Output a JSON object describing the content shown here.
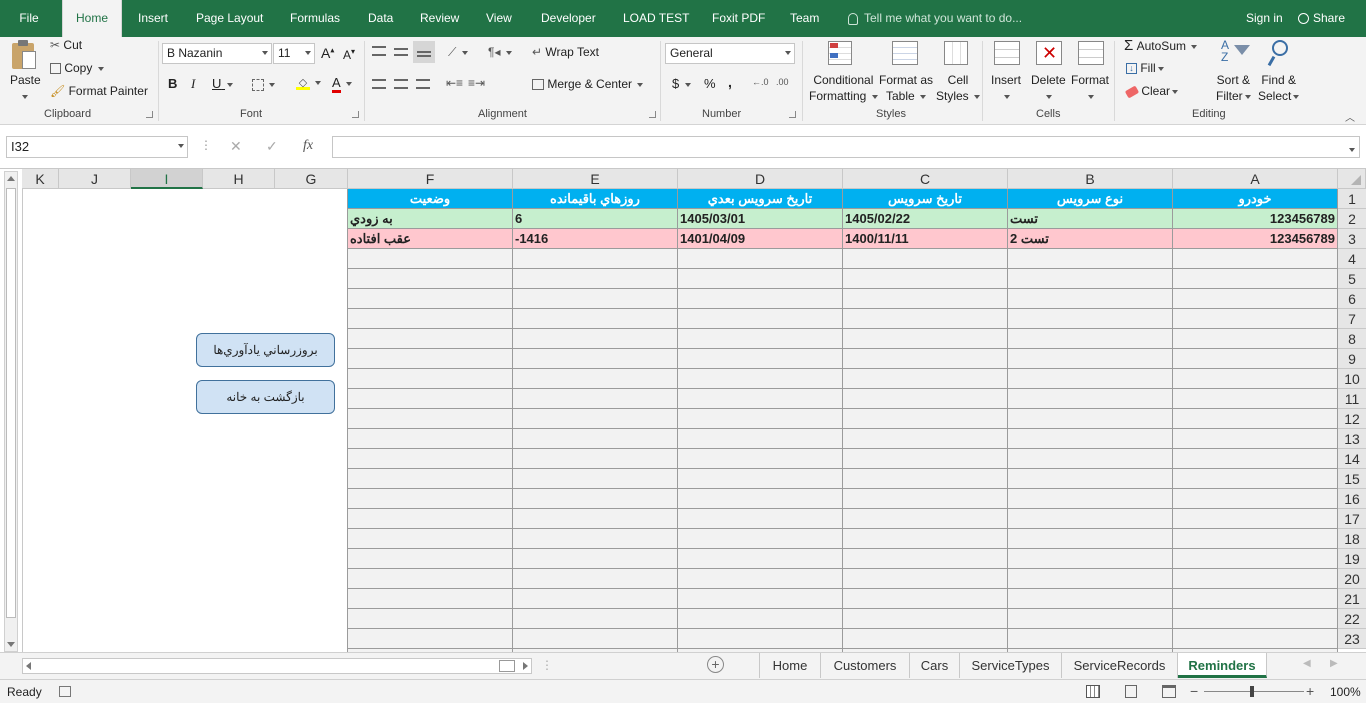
{
  "ribbon_tabs": {
    "file": "File",
    "home": "Home",
    "insert": "Insert",
    "page_layout": "Page Layout",
    "formulas": "Formulas",
    "data": "Data",
    "review": "Review",
    "view": "View",
    "developer": "Developer",
    "load_test": "LOAD TEST",
    "foxit": "Foxit PDF",
    "team": "Team",
    "tell_me": "Tell me what you want to do...",
    "sign_in": "Sign in",
    "share": "Share"
  },
  "clipboard": {
    "paste": "Paste",
    "cut": "Cut",
    "copy": "Copy",
    "format_painter": "Format Painter",
    "label": "Clipboard"
  },
  "font": {
    "name": "B Nazanin",
    "size": "11",
    "label": "Font",
    "bold": "B",
    "italic": "I",
    "underline": "U",
    "grow": "A",
    "shrink": "A",
    "color": "A"
  },
  "alignment": {
    "wrap_text": "Wrap Text",
    "merge_center": "Merge & Center",
    "label": "Alignment"
  },
  "number": {
    "format": "General",
    "currency": "$",
    "percent": "%",
    "comma": ",",
    "label": "Number"
  },
  "styles": {
    "conditional": "Conditional",
    "formatting": "Formatting",
    "format_as": "Format as",
    "table": "Table",
    "cell": "Cell",
    "styles": "Styles",
    "label": "Styles"
  },
  "cells": {
    "insert": "Insert",
    "delete": "Delete",
    "format": "Format",
    "label": "Cells"
  },
  "editing": {
    "autosum": "AutoSum",
    "fill": "Fill",
    "clear": "Clear",
    "sort": "Sort &",
    "filter": "Filter",
    "find": "Find &",
    "select": "Select",
    "label": "Editing"
  },
  "formula_bar": {
    "name_box": "I32",
    "fx": "fx",
    "value": ""
  },
  "columns": [
    "K",
    "J",
    "I",
    "H",
    "G",
    "F",
    "E",
    "D",
    "C",
    "B",
    "A"
  ],
  "rows": [
    "1",
    "2",
    "3",
    "4",
    "5",
    "6",
    "7",
    "8",
    "9",
    "10",
    "11",
    "12",
    "13",
    "14",
    "15",
    "16",
    "17",
    "18",
    "19",
    "20",
    "21",
    "22",
    "23"
  ],
  "table": {
    "headers": [
      "خودرو",
      "نوع سرويس",
      "تاريخ سرويس",
      "تاريخ سرويس بعدي",
      "روزهاي باقيمانده",
      "وضعيت"
    ],
    "row2": [
      "123456789",
      "تست",
      "1405/02/22",
      "1405/03/01",
      "6",
      "به زودي"
    ],
    "row3": [
      "123456789",
      "تست 2",
      "1400/11/11",
      "1401/04/09",
      "-1416",
      "عقب افتاده"
    ]
  },
  "buttons": {
    "refresh": "بروزرساني يادآوري‌ها",
    "back_home": "بازگشت به خانه"
  },
  "sheet_tabs": [
    "Home",
    "Customers",
    "Cars",
    "ServiceTypes",
    "ServiceRecords",
    "Reminders"
  ],
  "status": {
    "ready": "Ready",
    "zoom": "100%"
  },
  "colors": {
    "accent": "#217346",
    "header_fill": "#00b0f0",
    "soon_fill": "#c6efce",
    "overdue_fill": "#ffc7ce"
  }
}
